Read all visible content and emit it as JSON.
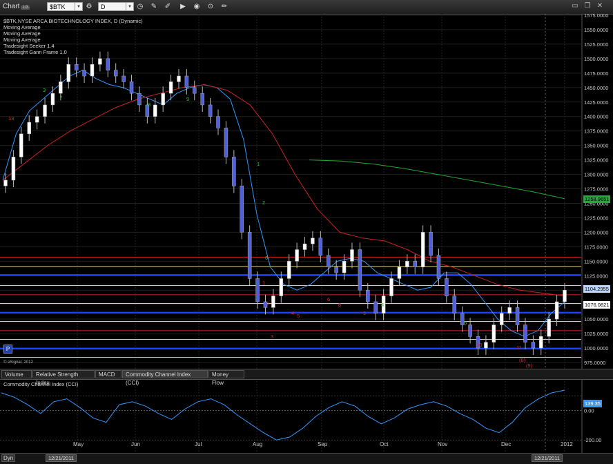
{
  "window": {
    "app_label": "Chart",
    "app_badge": "1/3",
    "symbol": "$BTK",
    "interval": "D",
    "controls": [
      "minimize-icon",
      "restore-icon",
      "close-icon"
    ]
  },
  "toolbar_icons": [
    "gear-icon",
    "clock-icon",
    "pencil-icon",
    "pencil-alt-icon",
    "play-icon",
    "record-icon",
    "pencil-strike-icon"
  ],
  "legend": [
    "$BTK,NYSE ARCA BIOTECHNOLOGY INDEX, D (Dynamic)",
    "Moving Average",
    "Moving Average",
    "Moving Average",
    "Tradesight Seeker 1.4",
    "Tradesight Gann Frame 1.0"
  ],
  "credit": "© eSignal, 2012",
  "p_button": "P",
  "price_axis": [
    "1575.0000",
    "1550.0000",
    "1525.0000",
    "1500.0000",
    "1475.0000",
    "1450.0000",
    "1425.0000",
    "1400.0000",
    "1375.0000",
    "1350.0000",
    "1325.0000",
    "1300.0000",
    "1275.0000",
    "1250.0000",
    "1225.0000",
    "1200.0000",
    "1175.0000",
    "1150.0000",
    "1125.0000",
    "1100.0000",
    "1075.0000",
    "1050.0000",
    "1025.0000",
    "1000.0000",
    "975.0000"
  ],
  "price_tags": [
    {
      "label": "1258.9651",
      "color": "#22aa33",
      "value": 1258.9651
    },
    {
      "label": "1104.2955",
      "color": "#bcd6ff",
      "value": 1104.2955
    },
    {
      "label": "1076.0821",
      "color": "#ffffff",
      "value": 1076.0821
    }
  ],
  "time_axis": [
    "May",
    "Jun",
    "Jul",
    "Aug",
    "Sep",
    "Oct",
    "Nov",
    "Dec",
    "2012"
  ],
  "tabs": [
    {
      "label": "Volume",
      "active": false
    },
    {
      "label": "Relative Strength Index",
      "active": false
    },
    {
      "label": "MACD",
      "active": false
    },
    {
      "label": "Commodity Channel Index (CCI)",
      "active": true
    },
    {
      "label": "Money Flow",
      "active": false
    }
  ],
  "cci": {
    "title": "Commodity Channel Index (CCI)",
    "axis": [
      "0.00",
      "-200.00"
    ],
    "value_tag": "139.35",
    "value": 139.35
  },
  "bottom": {
    "dyn": "Dyn",
    "date_left": "12/21/2011",
    "date_right": "12/21/2011"
  },
  "chart_data": {
    "type": "candlestick",
    "title": "$BTK,NYSE ARCA BIOTECHNOLOGY INDEX, D (Dynamic)",
    "ylim": [
      975,
      1575
    ],
    "y_ticks": [
      975,
      1000,
      1025,
      1050,
      1075,
      1100,
      1125,
      1150,
      1175,
      1200,
      1225,
      1250,
      1275,
      1300,
      1325,
      1350,
      1375,
      1400,
      1425,
      1450,
      1475,
      1500,
      1525,
      1550,
      1575
    ],
    "x_labels": [
      "May",
      "Jun",
      "Jul",
      "Aug",
      "Sep",
      "Oct",
      "Nov",
      "Dec",
      "2012"
    ],
    "approx_closes": [
      1290,
      1330,
      1370,
      1390,
      1400,
      1420,
      1440,
      1460,
      1490,
      1480,
      1470,
      1490,
      1500,
      1480,
      1470,
      1460,
      1440,
      1420,
      1400,
      1420,
      1440,
      1460,
      1470,
      1450,
      1440,
      1420,
      1400,
      1380,
      1330,
      1280,
      1200,
      1120,
      1080,
      1070,
      1090,
      1120,
      1150,
      1170,
      1180,
      1190,
      1160,
      1140,
      1130,
      1150,
      1170,
      1100,
      1080,
      1060,
      1090,
      1120,
      1140,
      1150,
      1140,
      1200,
      1160,
      1120,
      1090,
      1060,
      1040,
      1020,
      1000,
      1010,
      1040,
      1060,
      1070,
      1040,
      1010,
      1000,
      1020,
      1050,
      1080,
      1100
    ],
    "horizontal_levels": [
      {
        "value": 1157,
        "color": "#e02020"
      },
      {
        "value": 1141,
        "color": "#e8e020"
      },
      {
        "value": 1126,
        "color": "#2040ff"
      },
      {
        "value": 1108,
        "color": "#e8e020"
      },
      {
        "value": 1092,
        "color": "#e02020"
      },
      {
        "value": 1077,
        "color": "#e8e020"
      },
      {
        "value": 1061,
        "color": "#2040ff"
      },
      {
        "value": 1046,
        "color": "#e8e020"
      },
      {
        "value": 1030,
        "color": "#e02020"
      },
      {
        "value": 1015,
        "color": "#e8e020"
      },
      {
        "value": 999,
        "color": "#2040ff"
      },
      {
        "value": 984,
        "color": "#e8e020"
      }
    ],
    "moving_averages": [
      {
        "color": "#3399ff",
        "points": [
          1290,
          1370,
          1410,
          1430,
          1450,
          1470,
          1480,
          1465,
          1455,
          1450,
          1440,
          1430,
          1420,
          1440,
          1450,
          1455,
          1450,
          1430,
          1360,
          1230,
          1140,
          1110,
          1100,
          1110,
          1130,
          1150,
          1155,
          1150,
          1130,
          1120,
          1110,
          1100,
          1105,
          1130,
          1130,
          1110,
          1080,
          1050,
          1030,
          1020,
          1030,
          1060,
          1080
        ]
      },
      {
        "color": "#cc2222",
        "points": [
          1290,
          1320,
          1350,
          1375,
          1395,
          1415,
          1430,
          1440,
          1450,
          1455,
          1445,
          1420,
          1370,
          1300,
          1240,
          1200,
          1190,
          1185,
          1170,
          1150,
          1140,
          1125,
          1110,
          1100,
          1095,
          1090
        ]
      },
      {
        "color": "#22aa33",
        "points": [
          1325,
          1323,
          1318,
          1310,
          1300,
          1290,
          1280,
          1270,
          1258
        ]
      }
    ],
    "markers": {
      "green": [
        "3",
        "7",
        "8",
        "9",
        "1",
        "2",
        "6",
        "4",
        "5"
      ],
      "red": [
        "13",
        "1",
        "2",
        "3",
        "4",
        "5",
        "6",
        "8",
        "9",
        "10",
        "11",
        "(8)",
        "(9)"
      ]
    },
    "cci_series": [
      120,
      90,
      40,
      -20,
      60,
      80,
      20,
      -50,
      -80,
      40,
      60,
      30,
      -20,
      -60,
      10,
      60,
      80,
      40,
      -30,
      -90,
      -150,
      -200,
      -180,
      -120,
      -40,
      20,
      60,
      30,
      -40,
      -90,
      -50,
      10,
      40,
      60,
      30,
      -20,
      -60,
      -120,
      -150,
      -80,
      20,
      80,
      120,
      139
    ]
  }
}
